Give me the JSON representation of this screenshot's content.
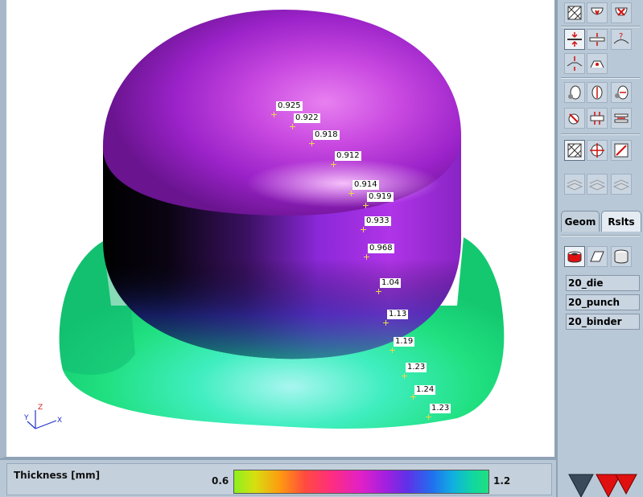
{
  "viewport": {
    "triad_axes": [
      "Z",
      "Y",
      "X"
    ],
    "thickness_readouts": [
      {
        "value": "0.925"
      },
      {
        "value": "0.922"
      },
      {
        "value": "0.918"
      },
      {
        "value": "0.912"
      },
      {
        "value": "0.914"
      },
      {
        "value": "0.919"
      },
      {
        "value": "0.933"
      },
      {
        "value": "0.968"
      },
      {
        "value": "1.04"
      },
      {
        "value": "1.13"
      },
      {
        "value": "1.19"
      },
      {
        "value": "1.23"
      },
      {
        "value": "1.24"
      },
      {
        "value": "1.23"
      }
    ]
  },
  "legend": {
    "title": "Thickness [mm]",
    "min": "0.6",
    "max": "1.2",
    "colormap": [
      "#8cf020",
      "#ff9a10",
      "#ff2e7e",
      "#e020c8",
      "#a020e0",
      "#2070f0",
      "#10d8a0"
    ]
  },
  "panel": {
    "tabs": {
      "geom": "Geom",
      "rslts": "Rslts"
    },
    "tools": [
      "20_die",
      "20_punch",
      "20_binder"
    ]
  },
  "colors": {
    "panel_bg": "#b9c8d6",
    "part_top": "#a020e0",
    "part_flange": "#20e080",
    "marker": "#e9d84a",
    "arrow_red": "#e01010",
    "arrow_dark": "#3a4a5a"
  }
}
